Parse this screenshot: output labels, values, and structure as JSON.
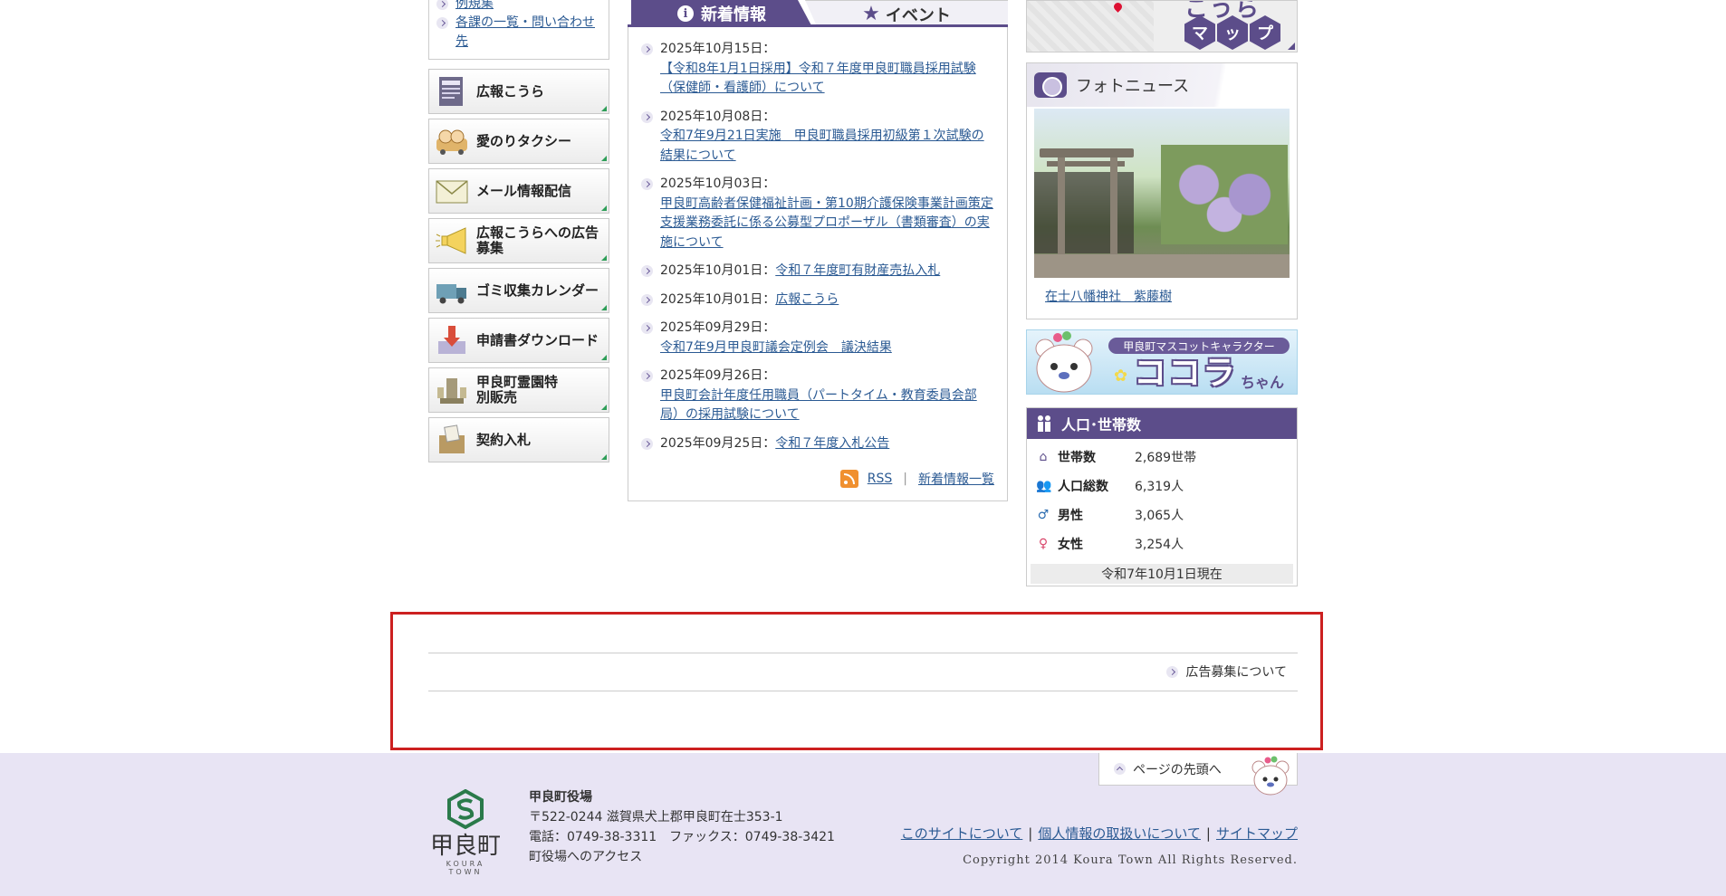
{
  "left": {
    "sub_links": [
      {
        "label": "例規集"
      },
      {
        "label": "各課の一覧・問い合わせ先"
      }
    ],
    "banners": [
      {
        "label": "広報こうら",
        "icon": "newsletter-icon"
      },
      {
        "label": "愛のりタクシー",
        "icon": "taxi-icon"
      },
      {
        "label": "メール情報配信",
        "icon": "mail-icon"
      },
      {
        "label": "広報こうらへの広告募集",
        "icon": "megaphone-icon"
      },
      {
        "label": "ゴミ収集カレンダー",
        "icon": "garbage-truck-icon"
      },
      {
        "label": "申請書ダウンロード",
        "icon": "download-icon"
      },
      {
        "label": "甲良町霊園特別販売",
        "icon": "cemetery-icon"
      },
      {
        "label": "契約入札",
        "icon": "contract-icon"
      }
    ]
  },
  "center": {
    "tabs": [
      {
        "label": "新着情報",
        "active": true
      },
      {
        "label": "イベント",
        "active": false
      }
    ],
    "news": [
      {
        "date": "2025年10月15日：",
        "title": "【令和8年1月1日採用】令和７年度甲良町職員採用試験（保健師・看護師）について"
      },
      {
        "date": "2025年10月08日：",
        "title": "令和7年9月21日実施　甲良町職員採用初級第１次試験の結果について"
      },
      {
        "date": "2025年10月03日：",
        "title": "甲良町高齢者保健福祉計画・第10期介護保険事業計画策定支援業務委託に係る公募型プロポーザル（書類審査）の実施について"
      },
      {
        "date": "2025年10月01日：",
        "title": "令和７年度町有財産売払入札"
      },
      {
        "date": "2025年10月01日：",
        "title": "広報こうら"
      },
      {
        "date": "2025年09月29日：",
        "title": "令和7年9月甲良町議会定例会　議決結果"
      },
      {
        "date": "2025年09月26日：",
        "title": "甲良町会計年度任用職員（パートタイム・教育委員会部局）の採用試験について"
      },
      {
        "date": "2025年09月25日：",
        "title": "令和７年度入札公告"
      }
    ],
    "rss_label": "RSS",
    "more_label": "新着情報一覧"
  },
  "right": {
    "map": {
      "title": "こうら",
      "hex_chars": [
        "マ",
        "ッ",
        "プ"
      ]
    },
    "photo": {
      "heading": "フォトニュース",
      "caption": "在士八幡神社　紫藤樹"
    },
    "mascot": {
      "subtitle": "甲良町マスコットキャラクター",
      "name": "ココラ",
      "suffix": "ちゃん"
    },
    "population": {
      "heading": "人口･世帯数",
      "rows": [
        {
          "key": "世帯数",
          "value": "2,689世帯",
          "icon": "house-icon",
          "color": "#5c4d8a"
        },
        {
          "key": "人口総数",
          "value": "6,319人",
          "icon": "people-icon",
          "color": "#2e8b57"
        },
        {
          "key": "男性",
          "value": "3,065人",
          "icon": "male-icon",
          "color": "#2b6cb0"
        },
        {
          "key": "女性",
          "value": "3,254人",
          "icon": "female-icon",
          "color": "#d9476b"
        }
      ],
      "as_of": "令和7年10月1日現在"
    }
  },
  "ad": {
    "link_label": "広告募集について"
  },
  "footer": {
    "page_top": "ページの先頭へ",
    "logo_name": "甲良町",
    "logo_en": "KOURA TOWN",
    "org": "甲良町役場",
    "address": "〒522-0244 滋賀県犬上郡甲良町在士353-1",
    "phone": "電話：0749-38-3311　ファックス：0749-38-3421",
    "access": "町役場へのアクセス",
    "links": [
      "このサイトについて",
      "個人情報の取扱いについて",
      "サイトマップ"
    ],
    "copyright": "Copyright 2014 Koura Town All Rights Reserved."
  },
  "colors": {
    "accent": "#5c4d8a",
    "link": "#2b5a93",
    "footer_bg": "#e8e4f4",
    "highlight_border": "#cc2020"
  }
}
